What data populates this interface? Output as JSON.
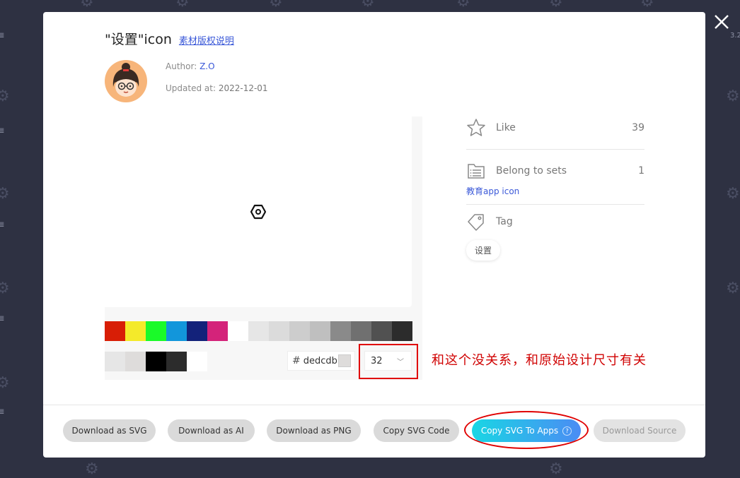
{
  "background": {
    "side_labels": [
      "3.2",
      "≣",
      "≣",
      "≣",
      "≣",
      "≣"
    ]
  },
  "modal": {
    "title": "\"设置\"icon",
    "license_link": "素材版权说明",
    "author_label": "Author:",
    "author_name": "Z.O",
    "updated_label": "Updated at:",
    "updated_date": "2022-12-01"
  },
  "preview": {
    "icon_name": "gear-icon",
    "palette_row1": [
      "#d81e06",
      "#f4ea2a",
      "#1afa29",
      "#1296db",
      "#13227a",
      "#d4237a",
      "#ffffff",
      "#e6e6e6",
      "#dbdbdb",
      "#cdcdcd",
      "#bfbfbf",
      "#8a8a8a",
      "#707070",
      "#515151",
      "#2c2c2c"
    ],
    "palette_row2": [
      "#e6e6e6",
      "#dedcdb",
      "#000000",
      "#2c2c2c",
      "#ffffff"
    ],
    "hex_value": "dedcdb",
    "size_value": "32"
  },
  "sidebar": {
    "like_label": "Like",
    "like_count": "39",
    "sets_label": "Belong to sets",
    "sets_count": "1",
    "set_name": "教育app icon",
    "tag_label": "Tag",
    "tag_value": "设置"
  },
  "footer": {
    "buttons": [
      {
        "label": "Download as SVG",
        "enabled": true
      },
      {
        "label": "Download as AI",
        "enabled": true
      },
      {
        "label": "Download as PNG",
        "enabled": true
      },
      {
        "label": "Copy SVG Code",
        "enabled": true
      },
      {
        "label": "Copy SVG To Apps",
        "enabled": true
      },
      {
        "label": "Download Source",
        "enabled": false
      }
    ]
  },
  "annotation": {
    "note": "和这个没关系，和原始设计尺寸有关"
  },
  "colors": {
    "accent": "#3a58d8",
    "annotation": "#e00000"
  }
}
